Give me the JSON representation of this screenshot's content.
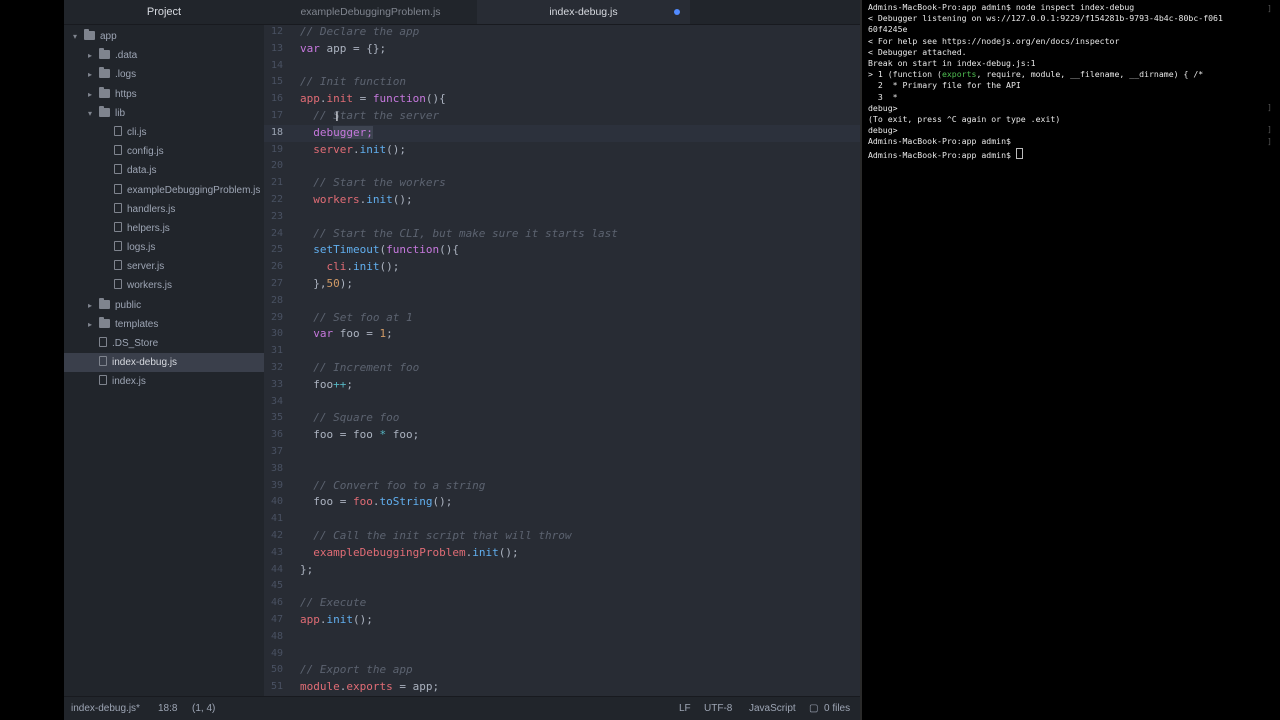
{
  "tree": {
    "header": "Project",
    "items": [
      {
        "label": "app",
        "type": "folder",
        "depth": 0,
        "open": true,
        "chev": "▾"
      },
      {
        "label": ".data",
        "type": "folder",
        "depth": 1,
        "open": false,
        "chev": "▸"
      },
      {
        "label": ".logs",
        "type": "folder",
        "depth": 1,
        "open": false,
        "chev": "▸"
      },
      {
        "label": "https",
        "type": "folder",
        "depth": 1,
        "open": false,
        "chev": "▸"
      },
      {
        "label": "lib",
        "type": "folder",
        "depth": 1,
        "open": true,
        "chev": "▾"
      },
      {
        "label": "cli.js",
        "type": "file",
        "depth": 2
      },
      {
        "label": "config.js",
        "type": "file",
        "depth": 2
      },
      {
        "label": "data.js",
        "type": "file",
        "depth": 2
      },
      {
        "label": "exampleDebuggingProblem.js",
        "type": "file",
        "depth": 2
      },
      {
        "label": "handlers.js",
        "type": "file",
        "depth": 2
      },
      {
        "label": "helpers.js",
        "type": "file",
        "depth": 2
      },
      {
        "label": "logs.js",
        "type": "file",
        "depth": 2
      },
      {
        "label": "server.js",
        "type": "file",
        "depth": 2
      },
      {
        "label": "workers.js",
        "type": "file",
        "depth": 2
      },
      {
        "label": "public",
        "type": "folder",
        "depth": 1,
        "open": false,
        "chev": "▸"
      },
      {
        "label": "templates",
        "type": "folder",
        "depth": 1,
        "open": false,
        "chev": "▸"
      },
      {
        "label": ".DS_Store",
        "type": "file",
        "depth": 1
      },
      {
        "label": "index-debug.js",
        "type": "file",
        "depth": 1,
        "selected": true
      },
      {
        "label": "index.js",
        "type": "file",
        "depth": 1
      }
    ]
  },
  "tabs": [
    {
      "label": "exampleDebuggingProblem.js",
      "active": false,
      "modified": false
    },
    {
      "label": "index-debug.js",
      "active": true,
      "modified": true
    }
  ],
  "code": {
    "current_line": 18,
    "lines": [
      {
        "n": "12",
        "tokens": [
          [
            "t-comment",
            "// Declare the app"
          ]
        ]
      },
      {
        "n": "13",
        "tokens": [
          [
            "t-keyword",
            "var"
          ],
          [
            "t-plain",
            " app = {};"
          ]
        ]
      },
      {
        "n": "14",
        "tokens": []
      },
      {
        "n": "15",
        "tokens": [
          [
            "t-comment",
            "// Init function"
          ]
        ]
      },
      {
        "n": "16",
        "tokens": [
          [
            "t-var",
            "app"
          ],
          [
            "t-plain",
            "."
          ],
          [
            "t-var",
            "init"
          ],
          [
            "t-plain",
            " = "
          ],
          [
            "t-keyword",
            "function"
          ],
          [
            "t-plain",
            "(){"
          ]
        ]
      },
      {
        "n": "17",
        "tokens": [
          [
            "t-comment",
            "  // Start the server"
          ]
        ]
      },
      {
        "n": "18",
        "tokens": [
          [
            "t-plain",
            "  "
          ],
          [
            "t-keyword",
            "deb"
          ],
          [
            "t-sel",
            "ugger;"
          ]
        ]
      },
      {
        "n": "19",
        "tokens": [
          [
            "t-plain",
            "  "
          ],
          [
            "t-var",
            "server"
          ],
          [
            "t-plain",
            "."
          ],
          [
            "t-fn",
            "init"
          ],
          [
            "t-plain",
            "();"
          ]
        ]
      },
      {
        "n": "20",
        "tokens": []
      },
      {
        "n": "21",
        "tokens": [
          [
            "t-comment",
            "  // Start the workers"
          ]
        ]
      },
      {
        "n": "22",
        "tokens": [
          [
            "t-plain",
            "  "
          ],
          [
            "t-var",
            "workers"
          ],
          [
            "t-plain",
            "."
          ],
          [
            "t-fn",
            "init"
          ],
          [
            "t-plain",
            "();"
          ]
        ]
      },
      {
        "n": "23",
        "tokens": []
      },
      {
        "n": "24",
        "tokens": [
          [
            "t-comment",
            "  // Start the CLI, but make sure it starts last"
          ]
        ]
      },
      {
        "n": "25",
        "tokens": [
          [
            "t-plain",
            "  "
          ],
          [
            "t-fn",
            "setTimeout"
          ],
          [
            "t-plain",
            "("
          ],
          [
            "t-keyword",
            "function"
          ],
          [
            "t-plain",
            "(){"
          ]
        ]
      },
      {
        "n": "26",
        "tokens": [
          [
            "t-plain",
            "    "
          ],
          [
            "t-var",
            "cli"
          ],
          [
            "t-plain",
            "."
          ],
          [
            "t-fn",
            "init"
          ],
          [
            "t-plain",
            "();"
          ]
        ]
      },
      {
        "n": "27",
        "tokens": [
          [
            "t-plain",
            "  },"
          ],
          [
            "t-num",
            "50"
          ],
          [
            "t-plain",
            ");"
          ]
        ]
      },
      {
        "n": "28",
        "tokens": []
      },
      {
        "n": "29",
        "tokens": [
          [
            "t-comment",
            "  // Set foo at 1"
          ]
        ]
      },
      {
        "n": "30",
        "tokens": [
          [
            "t-plain",
            "  "
          ],
          [
            "t-keyword",
            "var"
          ],
          [
            "t-plain",
            " foo = "
          ],
          [
            "t-num",
            "1"
          ],
          [
            "t-plain",
            ";"
          ]
        ]
      },
      {
        "n": "31",
        "tokens": []
      },
      {
        "n": "32",
        "tokens": [
          [
            "t-comment",
            "  // Increment foo"
          ]
        ]
      },
      {
        "n": "33",
        "tokens": [
          [
            "t-plain",
            "  foo"
          ],
          [
            "t-op",
            "++"
          ],
          [
            "t-plain",
            ";"
          ]
        ]
      },
      {
        "n": "34",
        "tokens": []
      },
      {
        "n": "35",
        "tokens": [
          [
            "t-comment",
            "  // Square foo"
          ]
        ]
      },
      {
        "n": "36",
        "tokens": [
          [
            "t-plain",
            "  foo = foo "
          ],
          [
            "t-op",
            "*"
          ],
          [
            "t-plain",
            " foo;"
          ]
        ]
      },
      {
        "n": "37",
        "tokens": []
      },
      {
        "n": "38",
        "tokens": []
      },
      {
        "n": "39",
        "tokens": [
          [
            "t-comment",
            "  // Convert foo to a string"
          ]
        ]
      },
      {
        "n": "40",
        "tokens": [
          [
            "t-plain",
            "  foo = "
          ],
          [
            "t-var",
            "foo"
          ],
          [
            "t-plain",
            "."
          ],
          [
            "t-fn",
            "toString"
          ],
          [
            "t-plain",
            "();"
          ]
        ]
      },
      {
        "n": "41",
        "tokens": []
      },
      {
        "n": "42",
        "tokens": [
          [
            "t-comment",
            "  // Call the init script that will throw"
          ]
        ]
      },
      {
        "n": "43",
        "tokens": [
          [
            "t-plain",
            "  "
          ],
          [
            "t-var",
            "exampleDebuggingProblem"
          ],
          [
            "t-plain",
            "."
          ],
          [
            "t-fn",
            "init"
          ],
          [
            "t-plain",
            "();"
          ]
        ]
      },
      {
        "n": "44",
        "tokens": [
          [
            "t-plain",
            "};"
          ]
        ]
      },
      {
        "n": "45",
        "tokens": []
      },
      {
        "n": "46",
        "tokens": [
          [
            "t-comment",
            "// Execute"
          ]
        ]
      },
      {
        "n": "47",
        "tokens": [
          [
            "t-var",
            "app"
          ],
          [
            "t-plain",
            "."
          ],
          [
            "t-fn",
            "init"
          ],
          [
            "t-plain",
            "();"
          ]
        ]
      },
      {
        "n": "48",
        "tokens": []
      },
      {
        "n": "49",
        "tokens": []
      },
      {
        "n": "50",
        "tokens": [
          [
            "t-comment",
            "// Export the app"
          ]
        ]
      },
      {
        "n": "51",
        "tokens": [
          [
            "t-var",
            "module"
          ],
          [
            "t-plain",
            "."
          ],
          [
            "t-var",
            "exports"
          ],
          [
            "t-plain",
            " = app;"
          ]
        ]
      }
    ]
  },
  "terminal": {
    "lines": [
      {
        "text": "Admins-MacBook-Pro:app admin$ node inspect index-debug"
      },
      {
        "text": "< Debugger listening on ws://127.0.0.1:9229/f154281b-9793-4b4c-80bc-f061"
      },
      {
        "text": "60f4245e"
      },
      {
        "text": "< For help see https://nodejs.org/en/docs/inspector"
      },
      {
        "text": "< Debugger attached."
      },
      {
        "text": "Break on start in index-debug.js:1"
      },
      {
        "text": "> 1 (function (",
        "green": "exports",
        "after": ", require, module, __filename, __dirname) { /*"
      },
      {
        "text": "  2  * Primary file for the API"
      },
      {
        "text": "  3  *"
      },
      {
        "text": "debug>"
      },
      {
        "text": "(To exit, press ^C again or type .exit)"
      },
      {
        "text": "debug>"
      },
      {
        "text": "Admins-MacBook-Pro:app admin$"
      },
      {
        "text": "Admins-MacBook-Pro:app admin$ ",
        "cursor": true
      }
    ]
  },
  "status": {
    "file": "index-debug.js*",
    "cursor_pos": "18:8",
    "selection": "(1, 4)",
    "line_ending": "LF",
    "encoding": "UTF-8",
    "grammar": "JavaScript",
    "git": "0 files"
  }
}
